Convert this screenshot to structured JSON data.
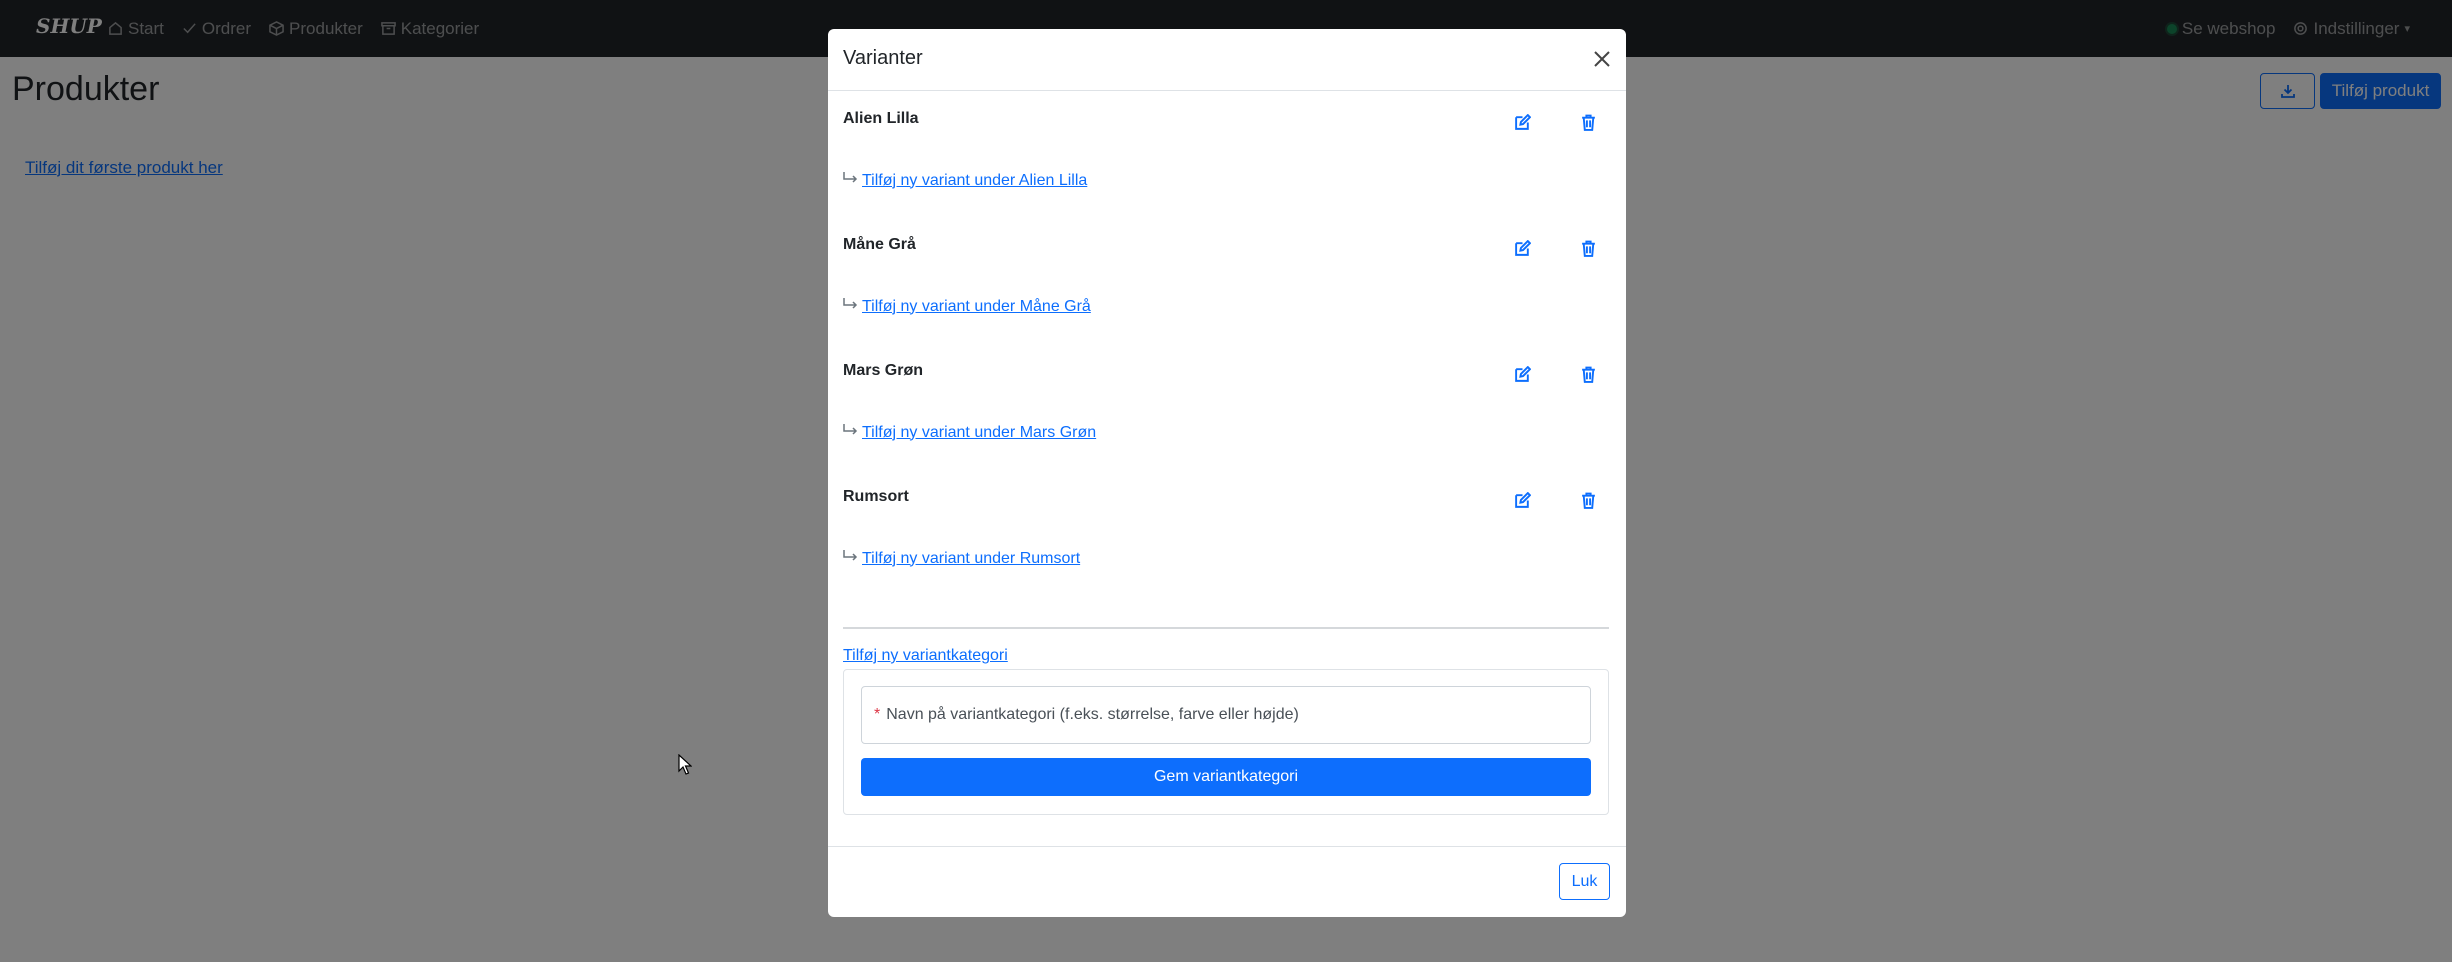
{
  "navbar": {
    "brand": "SHUP",
    "items": [
      {
        "label": "Start",
        "icon": "home-icon"
      },
      {
        "label": "Ordrer",
        "icon": "check-icon"
      },
      {
        "label": "Produkter",
        "icon": "box-icon"
      },
      {
        "label": "Kategorier",
        "icon": "archive-icon"
      }
    ],
    "webshop_label": "Se webshop",
    "settings_label": "Indstillinger",
    "status_color": "#198754"
  },
  "page": {
    "title": "Produkter",
    "add_product_label": "Tilføj produkt",
    "first_product_link": "Tilføj dit første produkt her",
    "export_icon": "download-icon"
  },
  "modal": {
    "title": "Varianter",
    "variants": [
      {
        "name": "Alien Lilla",
        "add_sub_label": "Tilføj ny variant under Alien Lilla"
      },
      {
        "name": "Måne Grå",
        "add_sub_label": "Tilføj ny variant under Måne Grå"
      },
      {
        "name": "Mars Grøn",
        "add_sub_label": "Tilføj ny variant under Mars Grøn"
      },
      {
        "name": "Rumsort",
        "add_sub_label": "Tilføj ny variant under Rumsort"
      }
    ],
    "add_category_link": "Tilføj ny variantkategori",
    "category_input_placeholder": "Navn på variantkategori (f.eks. størrelse, farve eller højde)",
    "required_marker": "*",
    "save_category_label": "Gem variantkategori",
    "close_label": "Luk"
  },
  "colors": {
    "primary": "#0d6efd",
    "navbar_bg": "#212529",
    "danger": "#dc3545"
  }
}
